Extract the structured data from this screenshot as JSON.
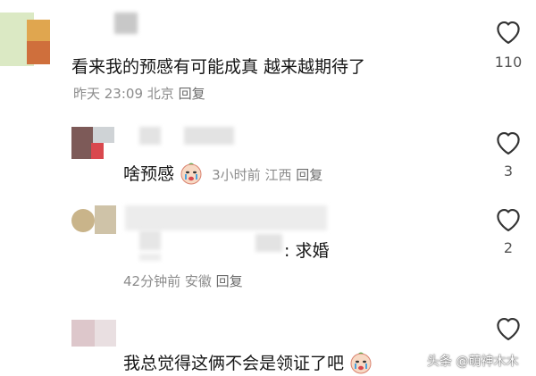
{
  "comments": [
    {
      "text": "看来我的预感有可能成真 越来越期待了",
      "time": "昨天 23:09",
      "location": "北京",
      "reply_label": "回复",
      "likes": "110"
    },
    {
      "text": "啥预感",
      "time": "3小时前",
      "location": "江西",
      "reply_label": "回复",
      "likes": "3"
    },
    {
      "text": "求婚",
      "time": "42分钟前",
      "location": "安徽",
      "reply_label": "回复",
      "likes": "2"
    },
    {
      "text": "我总觉得这俩不会是领证了吧"
    }
  ],
  "watermark": "头条 @萌神木木",
  "colors": {
    "text": "#161616",
    "meta": "#8c8c8c",
    "icon": "#333333",
    "blur_gray": "#e3e3e3"
  }
}
